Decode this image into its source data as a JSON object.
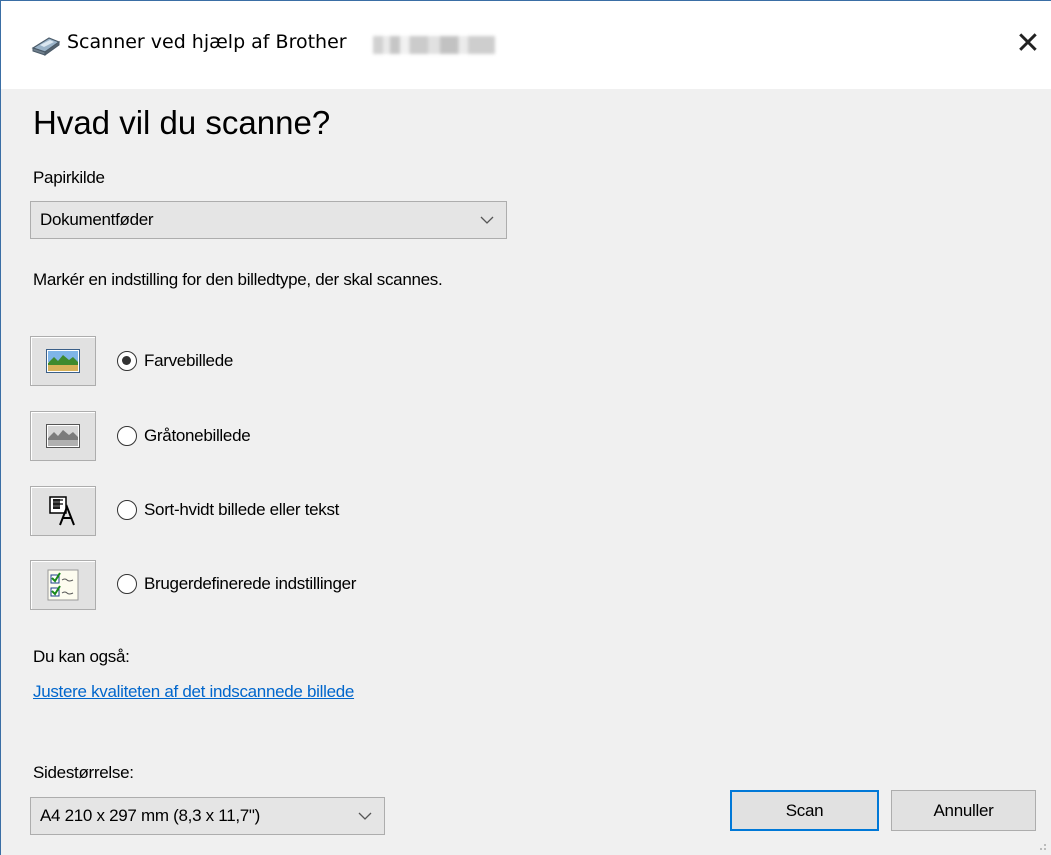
{
  "window": {
    "title": "Scanner ved hjælp af Brother",
    "close_glyph": "✕"
  },
  "heading": "Hvad vil du scanne?",
  "paper_source": {
    "label": "Papirkilde",
    "value": "Dokumentføder"
  },
  "instruction": "Markér en indstilling for den billedtype, der skal scannes.",
  "image_types": [
    {
      "label": "Farvebillede",
      "checked": true,
      "icon": "color-picture-icon"
    },
    {
      "label": "Gråtonebillede",
      "checked": false,
      "icon": "grayscale-picture-icon"
    },
    {
      "label": "Sort-hvidt billede eller tekst",
      "checked": false,
      "icon": "bw-picture-text-icon"
    },
    {
      "label": "Brugerdefinerede indstillinger",
      "checked": false,
      "icon": "custom-settings-icon"
    }
  ],
  "also": {
    "label": "Du kan også:",
    "link": "Justere kvaliteten af det indscannede billede"
  },
  "page_size": {
    "label": "Sidestørrelse:",
    "value": "A4 210 x 297 mm (8,3 x 11,7\")"
  },
  "buttons": {
    "scan": "Scan",
    "cancel": "Annuller"
  },
  "colors": {
    "link": "#0066cc",
    "primary_border": "#0078d7",
    "background": "#f0f0f0"
  }
}
